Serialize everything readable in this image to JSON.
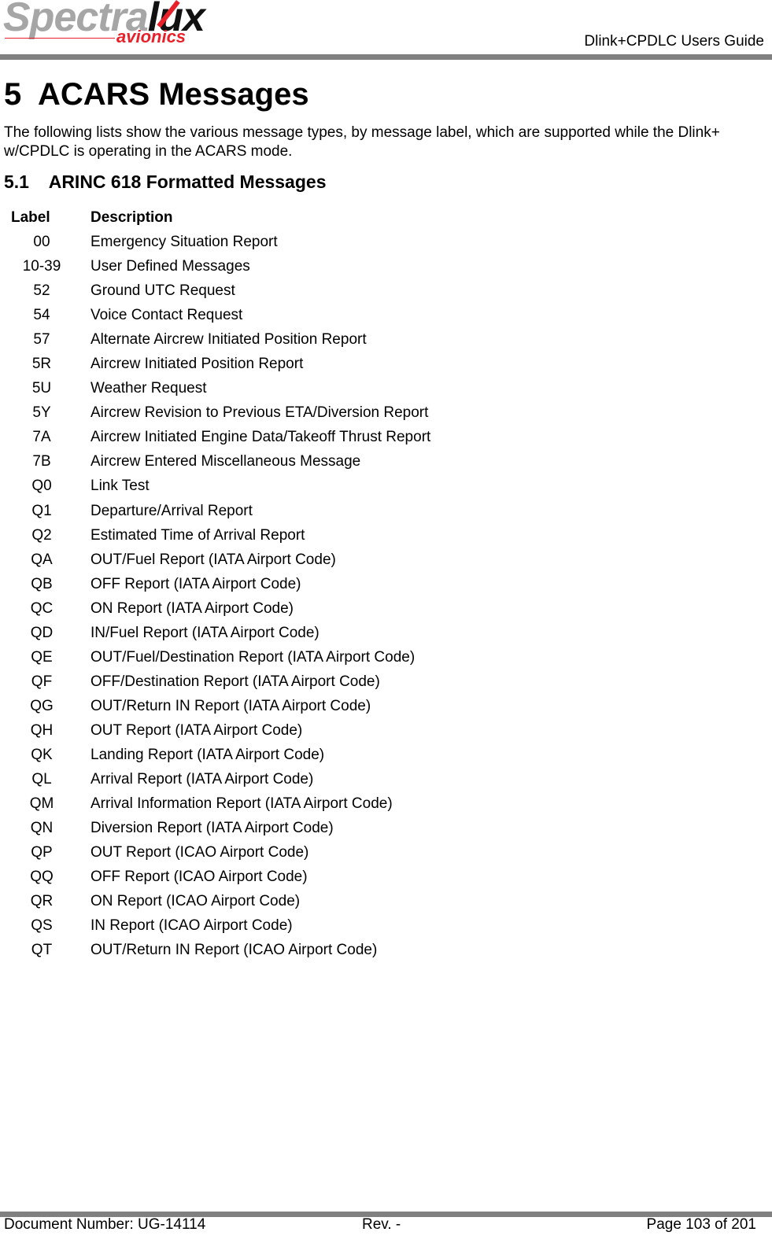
{
  "header": {
    "logo": {
      "brand_part1": "Spectra",
      "brand_part2": "lux",
      "tagline": "avionics"
    },
    "title": "Dlink+CPDLC Users Guide"
  },
  "section": {
    "number": "5",
    "title": "ACARS Messages",
    "intro": "The following lists show the various message types, by message label, which are supported while the Dlink+ w/CPDLC is operating in the ACARS mode."
  },
  "subsection": {
    "number": "5.1",
    "title": "ARINC 618 Formatted Messages"
  },
  "table": {
    "headers": {
      "label": "Label",
      "description": "Description"
    },
    "rows": [
      {
        "label": "00",
        "description": "Emergency Situation Report"
      },
      {
        "label": "10-39",
        "description": "User Defined Messages"
      },
      {
        "label": "52",
        "description": "Ground UTC Request"
      },
      {
        "label": "54",
        "description": "Voice Contact Request"
      },
      {
        "label": "57",
        "description": "Alternate Aircrew Initiated Position Report"
      },
      {
        "label": "5R",
        "description": "Aircrew Initiated Position Report"
      },
      {
        "label": "5U",
        "description": "Weather Request"
      },
      {
        "label": "5Y",
        "description": "Aircrew Revision to Previous ETA/Diversion Report"
      },
      {
        "label": "7A",
        "description": "Aircrew Initiated Engine Data/Takeoff Thrust Report"
      },
      {
        "label": "7B",
        "description": "Aircrew Entered Miscellaneous Message"
      },
      {
        "label": "Q0",
        "description": "Link Test"
      },
      {
        "label": "Q1",
        "description": "Departure/Arrival Report"
      },
      {
        "label": "Q2",
        "description": "Estimated Time of Arrival Report"
      },
      {
        "label": "QA",
        "description": "OUT/Fuel Report (IATA Airport Code)"
      },
      {
        "label": "QB",
        "description": "OFF Report (IATA Airport Code)"
      },
      {
        "label": "QC",
        "description": "ON Report (IATA Airport Code)"
      },
      {
        "label": "QD",
        "description": "IN/Fuel Report (IATA Airport Code)"
      },
      {
        "label": "QE",
        "description": "OUT/Fuel/Destination Report (IATA Airport Code)"
      },
      {
        "label": "QF",
        "description": "OFF/Destination Report (IATA Airport Code)"
      },
      {
        "label": "QG",
        "description": "OUT/Return IN Report (IATA Airport Code)"
      },
      {
        "label": "QH",
        "description": "OUT Report (IATA Airport Code)"
      },
      {
        "label": "QK",
        "description": "Landing Report (IATA Airport Code)"
      },
      {
        "label": "QL",
        "description": "Arrival Report (IATA Airport Code)"
      },
      {
        "label": "QM",
        "description": "Arrival Information Report (IATA Airport Code)"
      },
      {
        "label": "QN",
        "description": "Diversion Report (IATA Airport Code)"
      },
      {
        "label": "QP",
        "description": "OUT Report (ICAO Airport Code)"
      },
      {
        "label": "QQ",
        "description": "OFF Report (ICAO Airport Code)"
      },
      {
        "label": "QR",
        "description": "ON Report (ICAO Airport Code)"
      },
      {
        "label": "QS",
        "description": "IN Report (ICAO Airport Code)"
      },
      {
        "label": "QT",
        "description": "OUT/Return IN Report (ICAO Airport Code)"
      }
    ]
  },
  "footer": {
    "document_number": "Document Number:  UG-14114",
    "revision": "Rev. -",
    "page": "Page 103 of 201"
  },
  "colors": {
    "brand_red": "#e8202a",
    "brand_gray": "#a6a6a6",
    "rule_gray": "#808080"
  }
}
